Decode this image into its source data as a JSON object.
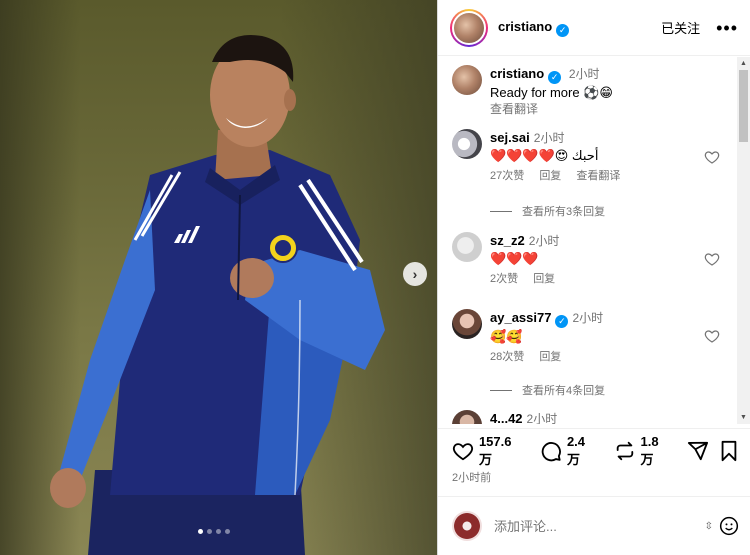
{
  "post": {
    "author": "cristiano",
    "follow_status": "已关注",
    "more_label": "•••",
    "next_label": "›",
    "carousel_count": 4,
    "carousel_active": 0
  },
  "caption": {
    "author": "cristiano",
    "time": "2小时",
    "text": "Ready for more ⚽😁",
    "translate": "查看翻译"
  },
  "comments": [
    {
      "user": "sej.sai",
      "time": "2小时",
      "text": "❤️❤️❤️❤️😍 أحبك",
      "likes": "27次赞",
      "reply": "回复",
      "translate": "查看翻译",
      "view_replies": "查看所有3条回复",
      "verified": false
    },
    {
      "user": "sz_z2",
      "time": "2小时",
      "text": "❤️❤️❤️",
      "likes": "2次赞",
      "reply": "回复",
      "verified": false
    },
    {
      "user": "ay_assi77",
      "time": "2小时",
      "text": "🥰🥰",
      "likes": "28次赞",
      "reply": "回复",
      "view_replies": "查看所有4条回复",
      "verified": true
    },
    {
      "user": "4...42",
      "time": "2小时"
    }
  ],
  "stats": {
    "likes": "157.6 万",
    "comments": "2.4 万",
    "reposts": "1.8 万",
    "posted": "2小时前"
  },
  "add_comment": {
    "placeholder": "添加评论..."
  },
  "colors": {
    "verified": "#0095f6",
    "jersey": "#1f2a78",
    "sleeve": "#3b6fd1",
    "secondary_text": "#737373"
  }
}
